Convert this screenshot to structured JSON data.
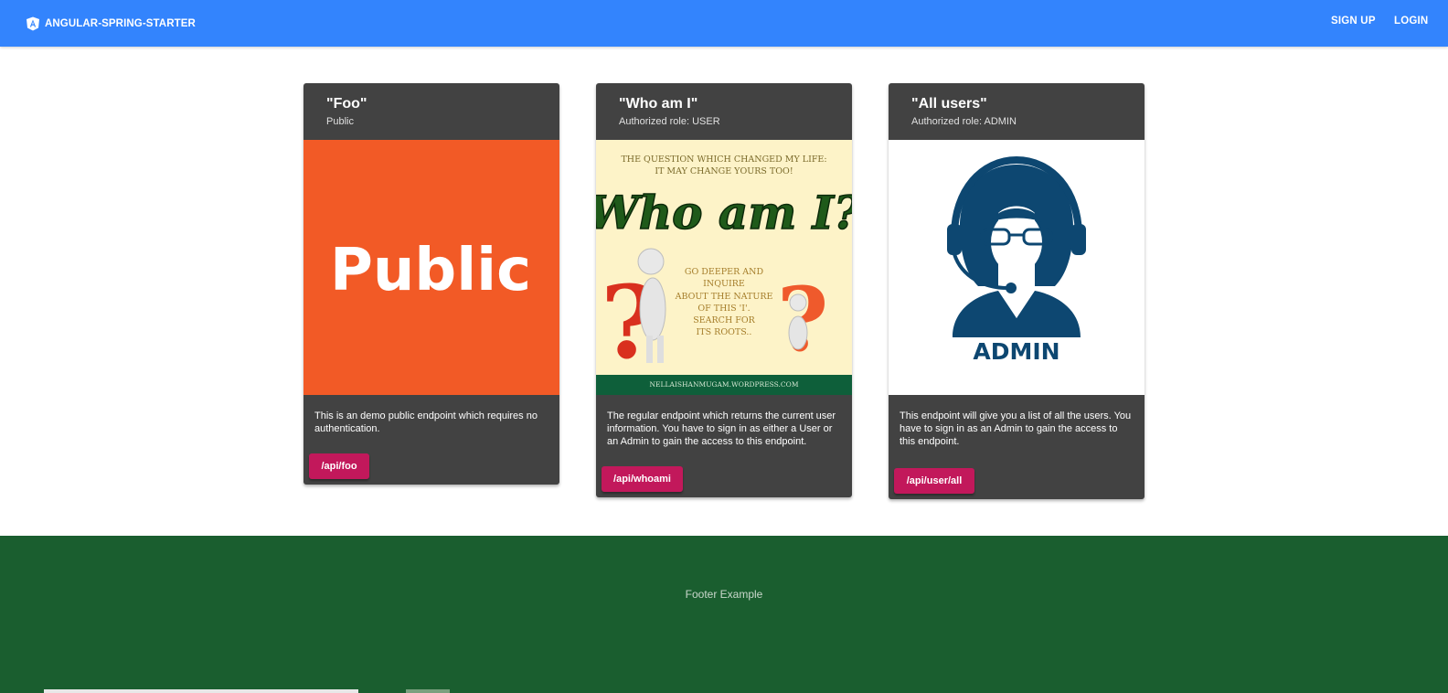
{
  "app": {
    "title": "ANGULAR-SPRING-STARTER",
    "icon": "angular-logo-icon"
  },
  "nav": {
    "signup": "SIGN UP",
    "login": "LOGIN"
  },
  "cards": [
    {
      "title": "\"Foo\"",
      "subtitle": "Public",
      "image": {
        "icon": "public-image",
        "text": "Public",
        "background": "#f25a26"
      },
      "description": "This is an demo public endpoint which requires no authentication.",
      "button": "/api/foo"
    },
    {
      "title": "\"Who am I\"",
      "subtitle": "Authorized role: USER",
      "image": {
        "icon": "who-am-i-image",
        "top_line1": "THE QUESTION WHICH CHANGED MY LIFE:",
        "top_line2": "IT MAY CHANGE YOURS TOO!",
        "headline": "Who am I?",
        "body_lines": [
          "GO DEEPER AND",
          "INQUIRE",
          "ABOUT THE NATURE",
          "OF THIS 'I'.",
          "SEARCH FOR",
          "ITS ROOTS.."
        ],
        "footer": "NELLAISHANMUGAM.WORDPRESS.COM",
        "background": "#fdf3c8"
      },
      "description": "The regular endpoint which returns the current user information. You have to sign in as either a User or an Admin to gain the access to this endpoint.",
      "button": "/api/whoami"
    },
    {
      "title": "\"All users\"",
      "subtitle": "Authorized role: ADMIN",
      "image": {
        "icon": "admin-image",
        "text": "ADMIN",
        "color": "#0d4771"
      },
      "description": "This endpoint will give you a list of all the users. You have to sign in as an Admin to gain the access to this endpoint.",
      "button": "/api/user/all"
    }
  ],
  "footer": {
    "text": "Footer Example"
  },
  "colors": {
    "toolbar": "#3384fd",
    "card": "#424242",
    "button": "#c2185b",
    "footer": "#1a5e2f"
  }
}
